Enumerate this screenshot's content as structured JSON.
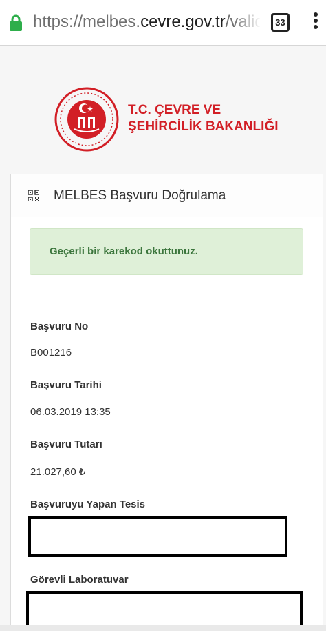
{
  "browser": {
    "url_scheme": "https://melbes.",
    "url_host": "cevre.gov.tr",
    "url_path": "/valida",
    "tab_count": "33",
    "lock_color": "#2eae4b"
  },
  "header": {
    "logo_line1": "T.C. ÇEVRE VE",
    "logo_line2": "ŞEHİRCİLİK BAKANLIĞI",
    "brand_color": "#d21f26"
  },
  "card": {
    "title": "MELBES Başvuru Doğrulama",
    "alert_text": "Geçerli bir karekod okuttunuz.",
    "fields": [
      {
        "label": "Başvuru No",
        "value": "B001216"
      },
      {
        "label": "Başvuru Tarihi",
        "value": "06.03.2019 13:35"
      },
      {
        "label": "Başvuru Tutarı",
        "value": "21.027,60 ₺"
      },
      {
        "label": "Başvuruyu Yapan Tesis",
        "value": ""
      },
      {
        "label": "Görevli Laboratuvar",
        "value": ""
      }
    ]
  }
}
